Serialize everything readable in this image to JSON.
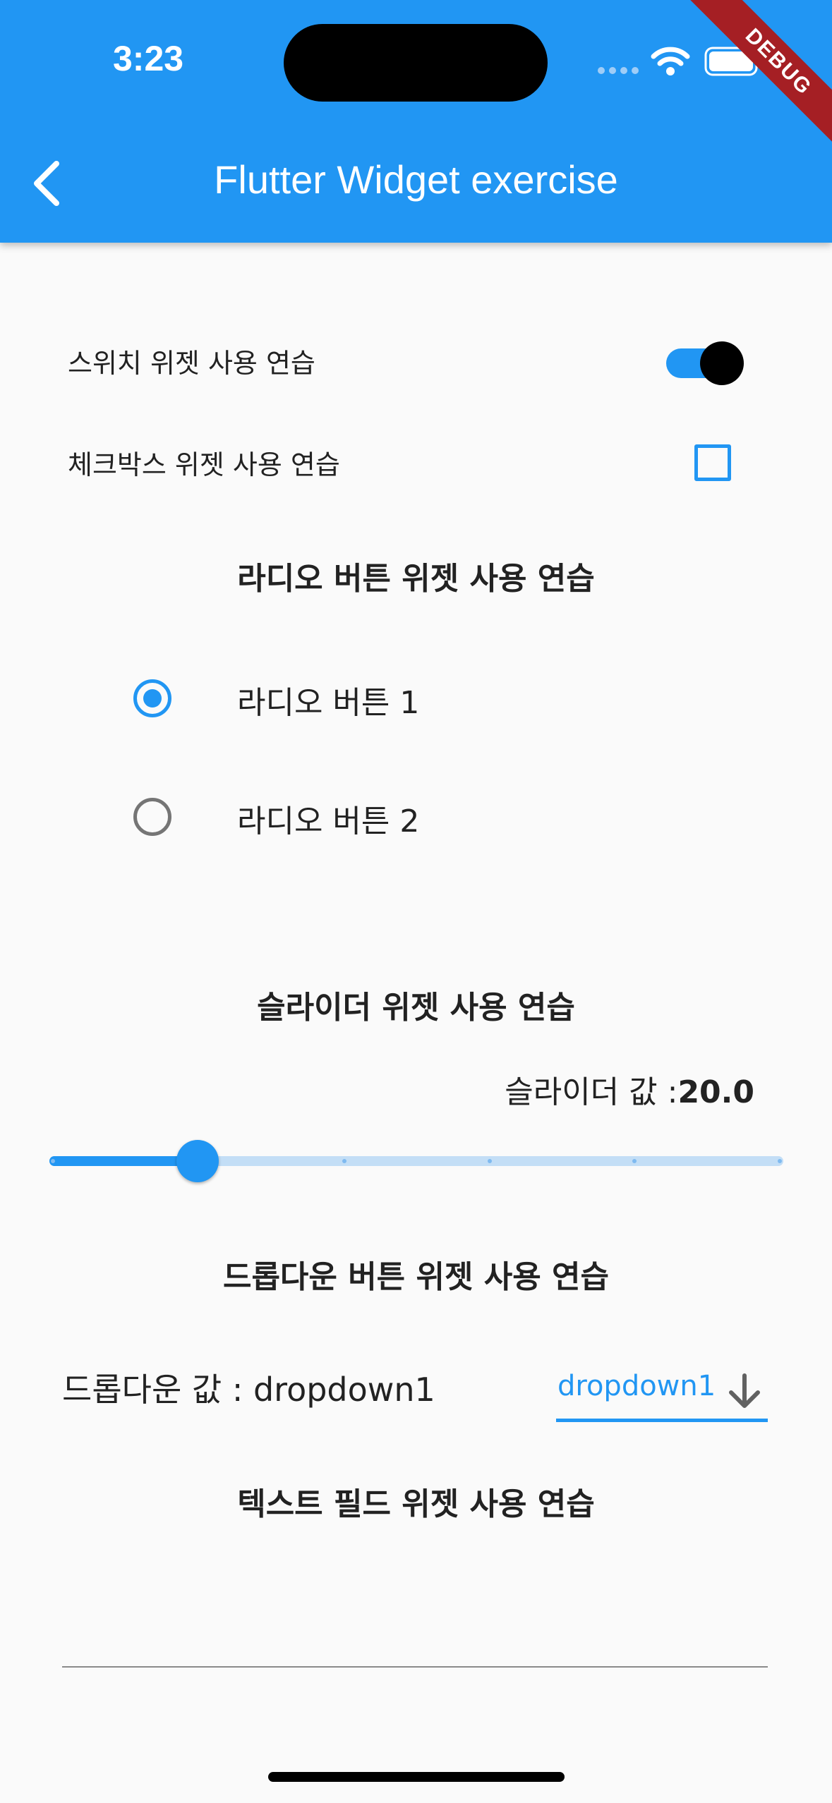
{
  "status_bar": {
    "time": "3:23"
  },
  "debug_banner": "DEBUG",
  "app_bar": {
    "title": "Flutter Widget exercise"
  },
  "switch_row": {
    "label": "스위치 위젯 사용 연습",
    "value": true
  },
  "checkbox_row": {
    "label": "체크박스 위젯 사용 연습",
    "checked": false
  },
  "radio_section": {
    "title": "라디오 버튼 위젯 사용 연습",
    "options": [
      {
        "label": "라디오 버튼 1",
        "selected": true
      },
      {
        "label": "라디오 버튼 2",
        "selected": false
      }
    ]
  },
  "slider_section": {
    "title": "슬라이더 위젯 사용 연습",
    "value_prefix": "슬라이더 값 :",
    "value_text": "20.0",
    "value": 20,
    "min": 0,
    "max": 100,
    "divisions": 5
  },
  "dropdown_section": {
    "title": "드롭다운 버튼 위젯 사용 연습",
    "value_label": "드롭다운 값 : dropdown1",
    "selected": "dropdown1"
  },
  "textfield_section": {
    "title": "텍스트 필드 위젯 사용 연습",
    "value": ""
  },
  "colors": {
    "primary": "#2196f3",
    "debug": "#a51f24",
    "background": "#fafafa"
  }
}
